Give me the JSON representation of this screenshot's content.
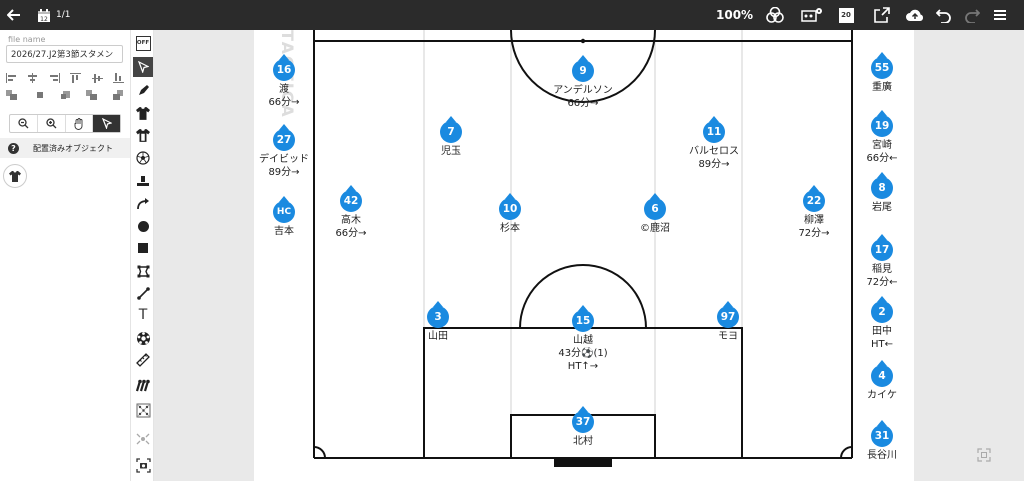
{
  "topbar": {
    "pages": "1/1",
    "calendar_day": "12",
    "zoom": "100%",
    "page_size": "20"
  },
  "left_panel": {
    "file_name_label": "file name",
    "file_name_value": "2026/27.J2第3節スタメン",
    "placed_objects_label": "配置済みオブジェクト"
  },
  "toolbar": {
    "off_label": "OFF",
    "text_tool": "T"
  },
  "canvas": {
    "watermark": "TACTICA"
  },
  "players": [
    {
      "num": "9",
      "name": "アンデルソン",
      "sub": "66分→",
      "color": "#1a8ae0"
    },
    {
      "num": "7",
      "name": "児玉",
      "sub": "",
      "color": "#1a8ae0"
    },
    {
      "num": "11",
      "name": "バルセロス",
      "sub": "89分→",
      "color": "#1a8ae0"
    },
    {
      "num": "42",
      "name": "高木",
      "sub": "66分→",
      "color": "#1a8ae0"
    },
    {
      "num": "10",
      "name": "杉本",
      "sub": "",
      "color": "#1a8ae0"
    },
    {
      "num": "6",
      "name": "©鹿沼",
      "sub": "",
      "color": "#1a8ae0"
    },
    {
      "num": "22",
      "name": "柳澤",
      "sub": "72分→",
      "color": "#1a8ae0"
    },
    {
      "num": "3",
      "name": "山田",
      "sub": "",
      "color": "#1a8ae0"
    },
    {
      "num": "15",
      "name": "山越",
      "sub": "43分⚽(1)",
      "sub2": "HT↑→",
      "color": "#1a8ae0"
    },
    {
      "num": "97",
      "name": "モヨ",
      "sub": "",
      "color": "#1a8ae0"
    },
    {
      "num": "37",
      "name": "北村",
      "sub": "",
      "color": "#1a8ae0"
    }
  ],
  "bench_left": [
    {
      "num": "16",
      "name": "渡",
      "sub": "66分→"
    },
    {
      "num": "27",
      "name": "デイビッド",
      "sub": "89分→"
    },
    {
      "num": "HC",
      "name": "吉本",
      "sub": ""
    }
  ],
  "bench_right": [
    {
      "num": "55",
      "name": "重廣",
      "sub": ""
    },
    {
      "num": "19",
      "name": "宮崎",
      "sub": "66分←"
    },
    {
      "num": "8",
      "name": "岩尾",
      "sub": ""
    },
    {
      "num": "17",
      "name": "稲見",
      "sub": "72分←"
    },
    {
      "num": "2",
      "name": "田中",
      "sub": "HT←"
    },
    {
      "num": "4",
      "name": "カイケ",
      "sub": ""
    },
    {
      "num": "31",
      "name": "長谷川",
      "sub": ""
    }
  ],
  "colors": {
    "topbar": "#2b2b2b",
    "marker": "#1a8ae0",
    "outside": "#e9e9e9"
  }
}
